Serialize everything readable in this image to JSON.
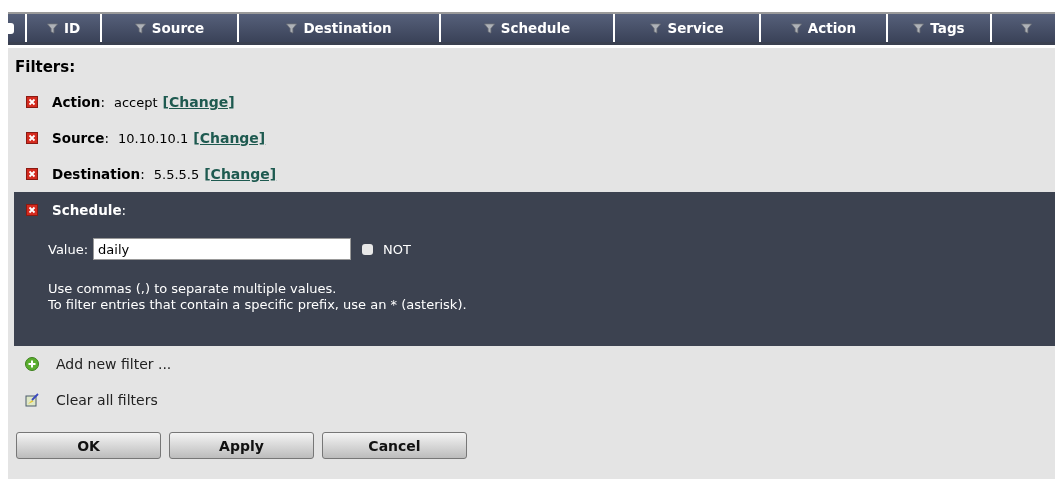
{
  "header_columns": [
    {
      "kind": "checkbox",
      "checked": false
    },
    {
      "kind": "filter",
      "label": "ID"
    },
    {
      "kind": "filter",
      "label": "Source"
    },
    {
      "kind": "filter",
      "label": "Destination"
    },
    {
      "kind": "filter",
      "label": "Schedule"
    },
    {
      "kind": "filter",
      "label": "Service"
    },
    {
      "kind": "filter",
      "label": "Action"
    },
    {
      "kind": "filter",
      "label": "Tags"
    },
    {
      "kind": "filter"
    }
  ],
  "filters_title": "Filters:",
  "filters": [
    {
      "field": "**Action**:",
      "value": "accept",
      "link": "[Change]",
      "expanded": false
    },
    {
      "field": "**Source**:",
      "value": "10.10.10.1",
      "link": "[Change]",
      "expanded": false
    },
    {
      "field": "**Destination**:",
      "value": "5.5.5.5",
      "link": "[Change]",
      "expanded": false
    },
    {
      "field": "**Schedule**:",
      "expanded": true,
      "value_label": "Value:",
      "input_value": "daily",
      "not_label": "NOT",
      "not_checked": false,
      "hints": [
        "Use commas (,) to separate multiple values.",
        "To filter entries that contain a specific prefix, use an * (asterisk)."
      ]
    }
  ],
  "actions": [
    {
      "kind": "add",
      "label": "Add new filter ..."
    },
    {
      "kind": "clear",
      "label": "Clear all filters"
    }
  ],
  "buttons": [
    "OK",
    "Apply",
    "Cancel"
  ]
}
